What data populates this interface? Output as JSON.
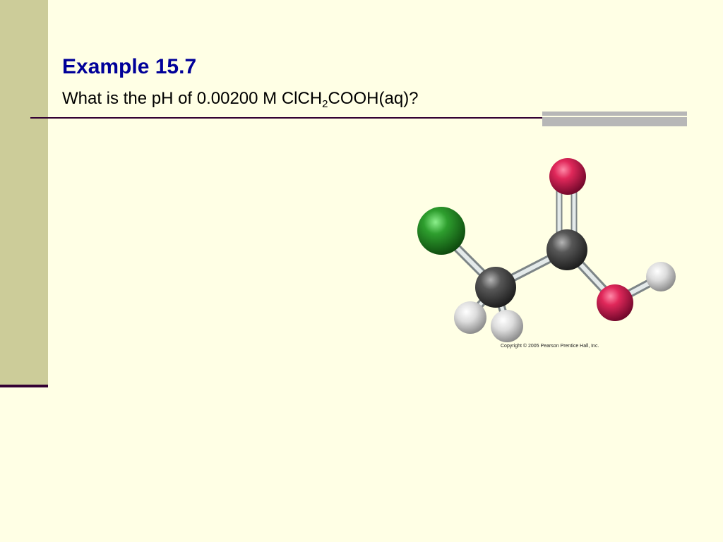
{
  "slide": {
    "title": "Example 15.7",
    "question": {
      "prefix": "What is the pH of 0.00200 M ClCH",
      "subscript": "2",
      "suffix": "COOH(aq)?"
    },
    "image_credit": "Copyright © 2005 Pearson Prentice Hall, Inc."
  },
  "molecule": {
    "name": "chloroacetic acid ball-and-stick model",
    "atoms": [
      {
        "element": "O",
        "role": "carbonyl-oxygen",
        "color": "#c8184a"
      },
      {
        "element": "Cl",
        "role": "chlorine",
        "color": "#2a9a2a"
      },
      {
        "element": "C",
        "role": "carboxyl-carbon",
        "color": "#4a4a4a"
      },
      {
        "element": "C",
        "role": "methylene-carbon",
        "color": "#4a4a4a"
      },
      {
        "element": "O",
        "role": "hydroxyl-oxygen",
        "color": "#c8184a"
      },
      {
        "element": "H",
        "role": "hydroxyl-hydrogen",
        "color": "#d8d8d8"
      },
      {
        "element": "H",
        "role": "methylene-hydrogen",
        "color": "#d8d8d8"
      },
      {
        "element": "H",
        "role": "methylene-hydrogen",
        "color": "#d8d8d8"
      }
    ]
  },
  "colors": {
    "background": "#ffffe5",
    "sidebar": "#cccc99",
    "title": "#000099",
    "rule": "#330033",
    "accent": "#b7b7b7"
  }
}
